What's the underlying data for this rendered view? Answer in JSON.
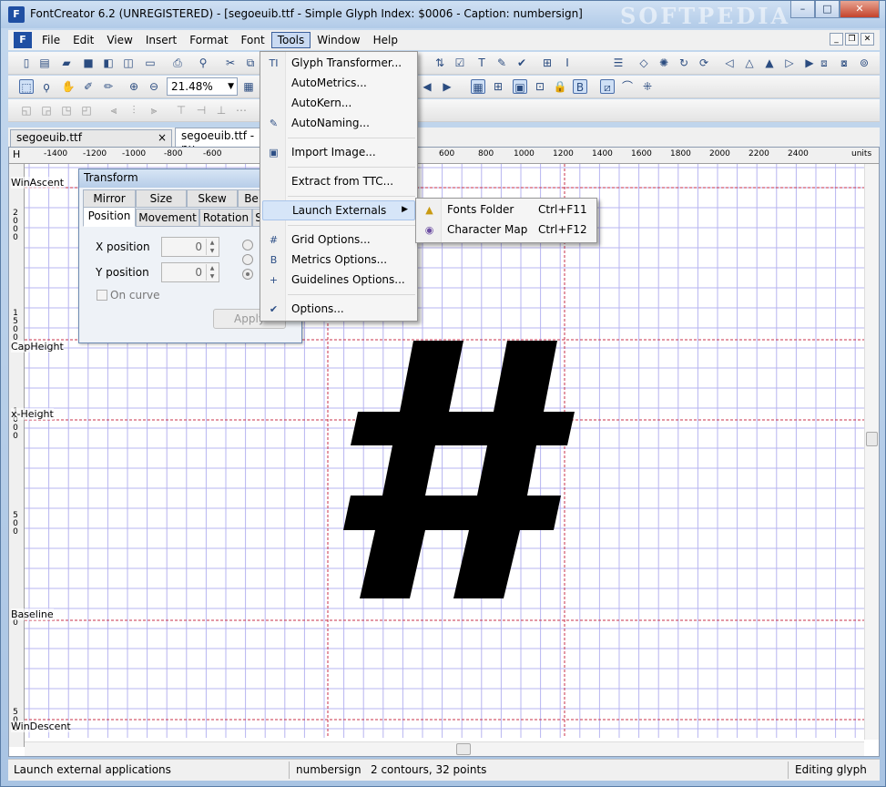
{
  "title": "FontCreator 6.2 (UNREGISTERED) - [segoeuib.ttf - Simple Glyph Index: $0006 - Caption: numbersign]",
  "watermark": "SOFTPEDIA",
  "window_controls": {
    "minimize": "–",
    "maximize": "□",
    "close": "✕"
  },
  "menu": {
    "icon": "F",
    "items": [
      "File",
      "Edit",
      "View",
      "Insert",
      "Format",
      "Font",
      "Tools",
      "Window",
      "Help"
    ],
    "active": "Tools"
  },
  "mdi_controls": {
    "minimize": "_",
    "restore": "❐",
    "close": "✕"
  },
  "toolbar": {
    "zoom": "21.48%"
  },
  "tabs": [
    {
      "label": "segoeuib.ttf",
      "close": "×"
    },
    {
      "label": "segoeuib.ttf - nu"
    }
  ],
  "ruler": {
    "corner": "H",
    "h_labels": [
      "-1400",
      "-1200",
      "-1000",
      "-800",
      "-600",
      "600",
      "800",
      "1000",
      "1200",
      "1400",
      "1600",
      "1800",
      "2000",
      "2200",
      "2400"
    ],
    "units": "units",
    "v_labels": [
      {
        "text": "2000"
      },
      {
        "text": "1500"
      },
      {
        "text": "1000"
      },
      {
        "text": "500"
      },
      {
        "text": "0"
      },
      {
        "text": "500"
      }
    ]
  },
  "guidelines": {
    "win_ascent": "WinAscent",
    "cap_height": "CapHeight",
    "x_height": "x-Height",
    "baseline": "Baseline",
    "win_descent": "WinDescent"
  },
  "transform_panel": {
    "title": "Transform",
    "tabs_row1": [
      "Mirror",
      "Size",
      "Skew",
      "Be"
    ],
    "tabs_row2": [
      "Position",
      "Movement",
      "Rotation",
      "S"
    ],
    "x_label": "X position",
    "x_value": "0",
    "y_label": "Y position",
    "y_value": "0",
    "on_curve": "On curve",
    "apply": "Apply"
  },
  "tools_menu": {
    "items": [
      {
        "label": "Glyph Transformer...",
        "icon": "TI"
      },
      {
        "label": "AutoMetrics...",
        "icon": ""
      },
      {
        "label": "AutoKern...",
        "icon": ""
      },
      {
        "label": "AutoNaming...",
        "icon": "✎"
      },
      {
        "label": "Import Image...",
        "icon": "▣"
      },
      {
        "label": "Extract from TTC...",
        "icon": ""
      },
      {
        "label": "Launch Externals",
        "icon": "",
        "submenu_arrow": "▶"
      },
      {
        "label": "Grid Options...",
        "icon": "#"
      },
      {
        "label": "Metrics Options...",
        "icon": "B"
      },
      {
        "label": "Guidelines Options...",
        "icon": "+"
      },
      {
        "label": "Options...",
        "icon": "✔"
      }
    ]
  },
  "launch_submenu": {
    "items": [
      {
        "label": "Fonts Folder",
        "shortcut": "Ctrl+F11",
        "icon": "▲"
      },
      {
        "label": "Character Map",
        "shortcut": "Ctrl+F12",
        "icon": "◉"
      }
    ]
  },
  "glyph_char": "#",
  "status": {
    "message": "Launch external applications",
    "glyph_name": "numbersign",
    "info": "2 contours, 32 points",
    "mode": "Editing glyph"
  },
  "colors": {
    "grid": "#b7b4f0",
    "guide": "#c8324a",
    "glyph": "#000000"
  }
}
